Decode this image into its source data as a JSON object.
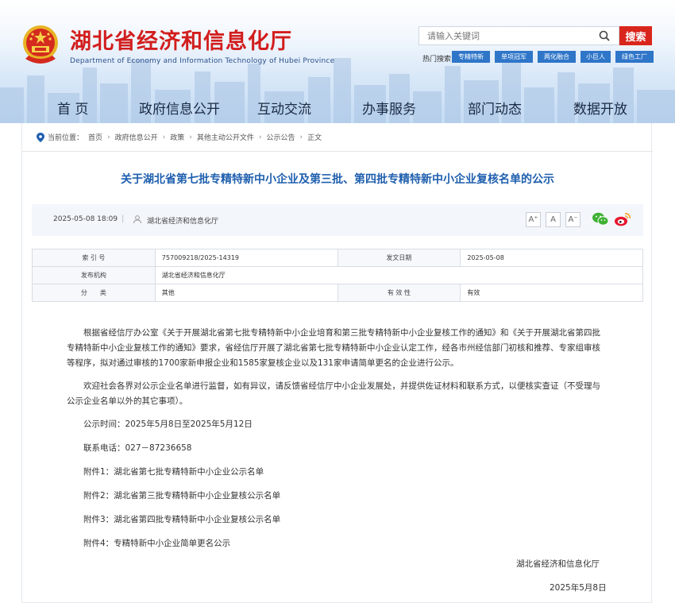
{
  "header": {
    "site_title": "湖北省经济和信息化厅",
    "site_subtitle": "Department of Economy and Information Technology of Hubei Province",
    "search_placeholder": "请输入关键词",
    "search_button": "搜索",
    "hot_label": "热门搜索:",
    "hot_tags": [
      "专精特新",
      "单项冠军",
      "两化融合",
      "小巨人",
      "绿色工厂"
    ],
    "accent_color": "#d9261c",
    "brand_blue": "#2f76c9"
  },
  "nav": {
    "items": [
      "首 页",
      "政府信息公开",
      "互动交流",
      "办事服务",
      "部门动态",
      "数据开放"
    ]
  },
  "breadcrumb": {
    "label": "当前位置：",
    "items": [
      "首页",
      "政府信息公开",
      "政策",
      "其他主动公开文件",
      "公示公告",
      "正文"
    ]
  },
  "article": {
    "title": "关于湖北省第七批专精特新中小企业及第三批、第四批专精特新中小企业复核名单的公示",
    "date": "2025-05-08 18:09",
    "divider": "|",
    "source": "湖北省经济和信息化厅",
    "font_sizes": [
      "A⁺",
      "A",
      "A⁻"
    ]
  },
  "info": {
    "index_label": "索 引 号",
    "index_value": "757009218/2025-14319",
    "publish_date_label": "发文日期",
    "publish_date_value": "2025-05-08",
    "issuer_label": "发布机构",
    "issuer_value": "湖北省经济和信息化厅",
    "category_label": "分　　类",
    "category_value": "其他",
    "validity_label": "有 效 性",
    "validity_value": "有效"
  },
  "body": {
    "p1": "根据省经信厅办公室《关于开展湖北省第七批专精特新中小企业培育和第三批专精特新中小企业复核工作的通知》和《关于开展湖北省第四批专精特新中小企业复核工作的通知》要求，省经信厅开展了湖北省第七批专精特新中小企业认定工作，经各市州经信部门初核和推荐、专家组审核等程序，拟对通过审核的1700家新申报企业和1585家复核企业以及131家申请简单更名的企业进行公示。",
    "p2": "欢迎社会各界对公示企业名单进行监督，如有异议，请反馈省经信厅中小企业发展处，并提供佐证材料和联系方式，以便核实查证（不受理与公示企业名单以外的其它事项）。",
    "period": "公示时间：2025年5月8日至2025年5月12日",
    "phone": "联系电话：027－87236658",
    "attachments": [
      "附件1：湖北省第七批专精特新中小企业公示名单",
      "附件2：湖北省第三批专精特新中小企业复核公示名单",
      "附件3：湖北省第四批专精特新中小企业复核公示名单",
      "附件4：专精特新中小企业简单更名公示"
    ],
    "sign": "湖北省经济和信息化厅",
    "sign_date": "2025年5月8日"
  }
}
